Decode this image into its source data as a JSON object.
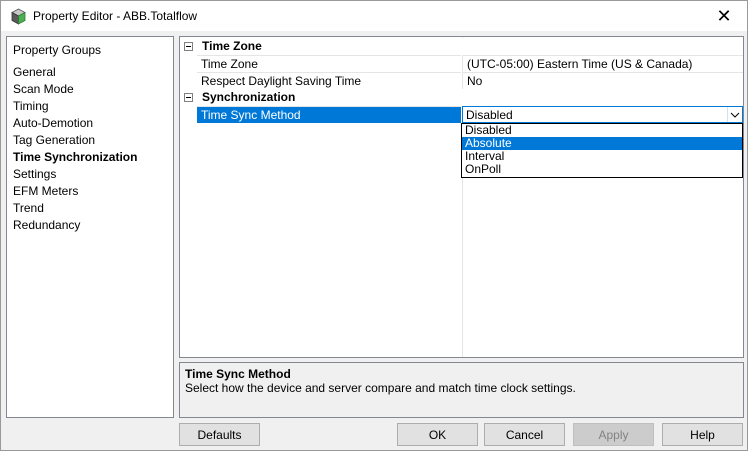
{
  "window": {
    "title": "Property Editor - ABB.Totalflow",
    "close_glyph": "✕"
  },
  "property_groups": {
    "header": "Property Groups",
    "items": [
      {
        "label": "General",
        "active": false
      },
      {
        "label": "Scan Mode",
        "active": false
      },
      {
        "label": "Timing",
        "active": false
      },
      {
        "label": "Auto-Demotion",
        "active": false
      },
      {
        "label": "Tag Generation",
        "active": false
      },
      {
        "label": "Time Synchronization",
        "active": true
      },
      {
        "label": "Settings",
        "active": false
      },
      {
        "label": "EFM Meters",
        "active": false
      },
      {
        "label": "Trend",
        "active": false
      },
      {
        "label": "Redundancy",
        "active": false
      }
    ]
  },
  "grid": {
    "categories": [
      {
        "label": "Time Zone",
        "properties": [
          {
            "name": "Time Zone",
            "value": "(UTC-05:00) Eastern Time (US & Canada)"
          },
          {
            "name": "Respect Daylight Saving Time",
            "value": "No"
          }
        ]
      },
      {
        "label": "Synchronization",
        "properties": [
          {
            "name": "Time Sync Method",
            "value": "Disabled"
          }
        ]
      }
    ],
    "dropdown_options": [
      "Disabled",
      "Absolute",
      "Interval",
      "OnPoll"
    ],
    "dropdown_highlighted": "Absolute"
  },
  "description": {
    "title": "Time Sync Method",
    "text": "Select how the device and server compare and match time clock settings."
  },
  "buttons": {
    "defaults": "Defaults",
    "ok": "OK",
    "cancel": "Cancel",
    "apply": "Apply",
    "help": "Help"
  },
  "colors": {
    "selection": "#0078d7",
    "icon": "icon-cube"
  }
}
